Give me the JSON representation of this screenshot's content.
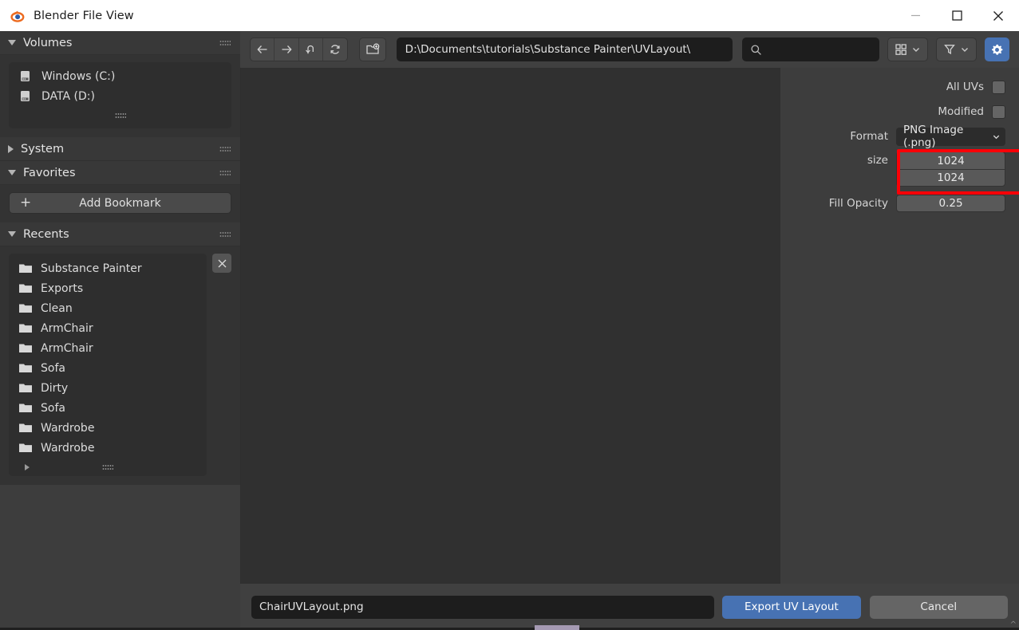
{
  "window": {
    "title": "Blender File View",
    "logo_icon": "blender-logo-icon",
    "minimize_icon": "minimize-icon",
    "maximize_icon": "maximize-icon",
    "close_icon": "close-icon",
    "accent_color": "#4772b3",
    "titlebar_bg": "#ffffff"
  },
  "sidebar": {
    "sections": [
      {
        "label": "Volumes",
        "expanded": true
      },
      {
        "label": "System",
        "expanded": false
      },
      {
        "label": "Favorites",
        "expanded": true
      },
      {
        "label": "Recents",
        "expanded": true
      }
    ],
    "volumes": [
      {
        "label": "Windows (C:)",
        "icon": "drive-icon"
      },
      {
        "label": "DATA (D:)",
        "icon": "drive-icon"
      }
    ],
    "favorites": {
      "add_bookmark_label": "Add Bookmark",
      "add_icon": "plus-icon"
    },
    "recents": {
      "clear_icon": "close-icon",
      "items": [
        {
          "label": "Substance Painter",
          "icon": "folder-icon"
        },
        {
          "label": "Exports",
          "icon": "folder-icon"
        },
        {
          "label": "Clean",
          "icon": "folder-icon"
        },
        {
          "label": "ArmChair",
          "icon": "folder-icon"
        },
        {
          "label": "ArmChair",
          "icon": "folder-icon"
        },
        {
          "label": "Sofa",
          "icon": "folder-icon"
        },
        {
          "label": "Dirty",
          "icon": "folder-icon"
        },
        {
          "label": "Sofa",
          "icon": "folder-icon"
        },
        {
          "label": "Wardrobe",
          "icon": "folder-icon"
        },
        {
          "label": "Wardrobe",
          "icon": "folder-icon"
        }
      ]
    }
  },
  "toolbar": {
    "back_icon": "arrow-left-icon",
    "forward_icon": "arrow-right-icon",
    "up_icon": "arrow-up-icon",
    "refresh_icon": "refresh-icon",
    "new_folder_icon": "new-folder-icon",
    "path_value": "D:\\Documents\\tutorials\\Substance Painter\\UVLayout\\",
    "search_placeholder": "",
    "search_value": "",
    "search_icon": "search-icon",
    "display_mode_icon": "grid-icon",
    "filter_icon": "funnel-icon",
    "chevron_icon": "chevron-down-icon",
    "options_icon": "gear-icon",
    "options_active": true
  },
  "properties": {
    "rows": [
      {
        "label": "All UVs",
        "type": "checkbox",
        "checked": false
      },
      {
        "label": "Modified",
        "type": "checkbox",
        "checked": false
      },
      {
        "label": "Format",
        "type": "dropdown",
        "value": "PNG Image (.png)"
      }
    ],
    "size": {
      "label": "size",
      "width_value": "1024",
      "height_value": "1024",
      "highlight_color": "#fb0007"
    },
    "fill_opacity": {
      "label": "Fill Opacity",
      "value": "0.25"
    }
  },
  "bottom": {
    "filename_value": "ChairUVLayout.png",
    "export_label": "Export UV Layout",
    "cancel_label": "Cancel"
  }
}
